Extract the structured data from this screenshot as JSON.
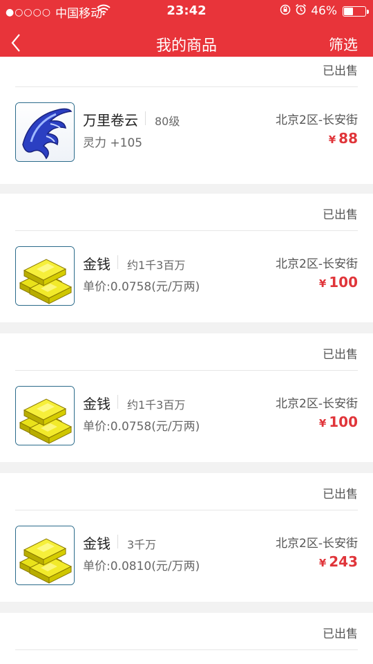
{
  "statusbar": {
    "carrier": "中国移动",
    "signal_dots": "●○○○○",
    "time": "23:42",
    "battery_percent": "46%",
    "battery_level": 0.46
  },
  "nav": {
    "title": "我的商品",
    "filter_label": "筛选"
  },
  "colors": {
    "brand": "#e8343a",
    "price": "#e0353a"
  },
  "currency_symbol": "¥",
  "items": [
    {
      "status": "已出售",
      "name": "",
      "sub": "",
      "detail": "",
      "server": "",
      "price": "",
      "icon": ""
    },
    {
      "status": "",
      "name": "万里卷云",
      "sub": "80级",
      "detail": "灵力 +105",
      "server": "北京2区-长安街",
      "price": "88",
      "icon": "blue-flame-item-icon"
    },
    {
      "status": "已出售",
      "name": "金钱",
      "sub": "约1千3百万",
      "detail": "单价:0.0758(元/万两)",
      "server": "北京2区-长安街",
      "price": "100",
      "icon": "gold-bars-icon"
    },
    {
      "status": "已出售",
      "name": "金钱",
      "sub": "约1千3百万",
      "detail": "单价:0.0758(元/万两)",
      "server": "北京2区-长安街",
      "price": "100",
      "icon": "gold-bars-icon"
    },
    {
      "status": "已出售",
      "name": "金钱",
      "sub": "3千万",
      "detail": "单价:0.0810(元/万两)",
      "server": "北京2区-长安街",
      "price": "243",
      "icon": "gold-bars-icon"
    },
    {
      "status": "已出售",
      "name": "",
      "sub": "",
      "detail": "",
      "server": "",
      "price": "",
      "icon": ""
    }
  ]
}
